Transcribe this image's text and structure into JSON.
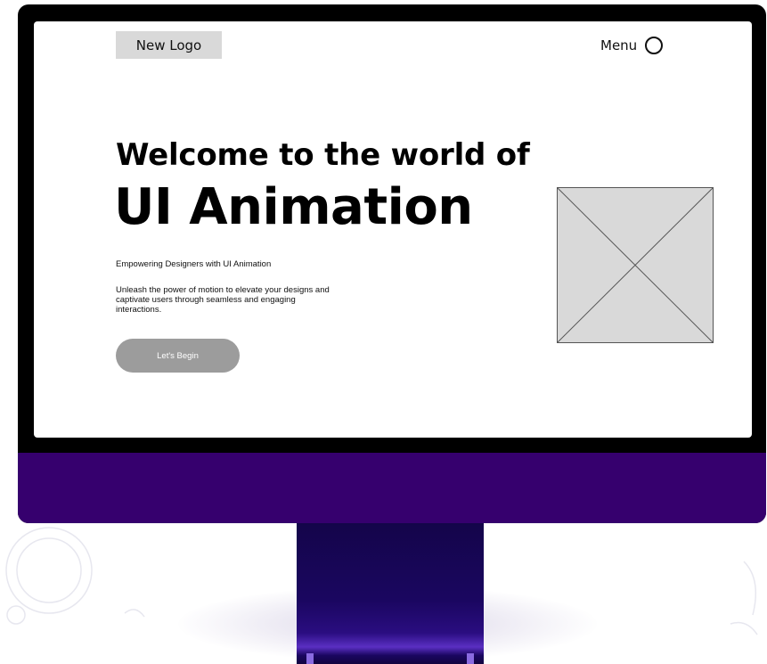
{
  "header": {
    "logo_text": "New Logo",
    "menu_label": "Menu"
  },
  "hero": {
    "title_line1": "Welcome to the world of",
    "title_line2": "UI Animation",
    "subheading": "Empowering Designers with UI Animation",
    "description": "Unleash the power of motion to elevate your designs and captivate users through seamless and engaging interactions.",
    "cta_label": "Let's Begin"
  },
  "icons": {
    "menu": "circle-icon",
    "image_placeholder": "image-placeholder-icon"
  },
  "colors": {
    "monitor_frame": "#000000",
    "monitor_chin": "#36006e",
    "stand": "#1a0660",
    "logo_background": "#d9d9d9",
    "cta_background": "#9c9c9c",
    "placeholder_fill": "#d9d9d9"
  }
}
